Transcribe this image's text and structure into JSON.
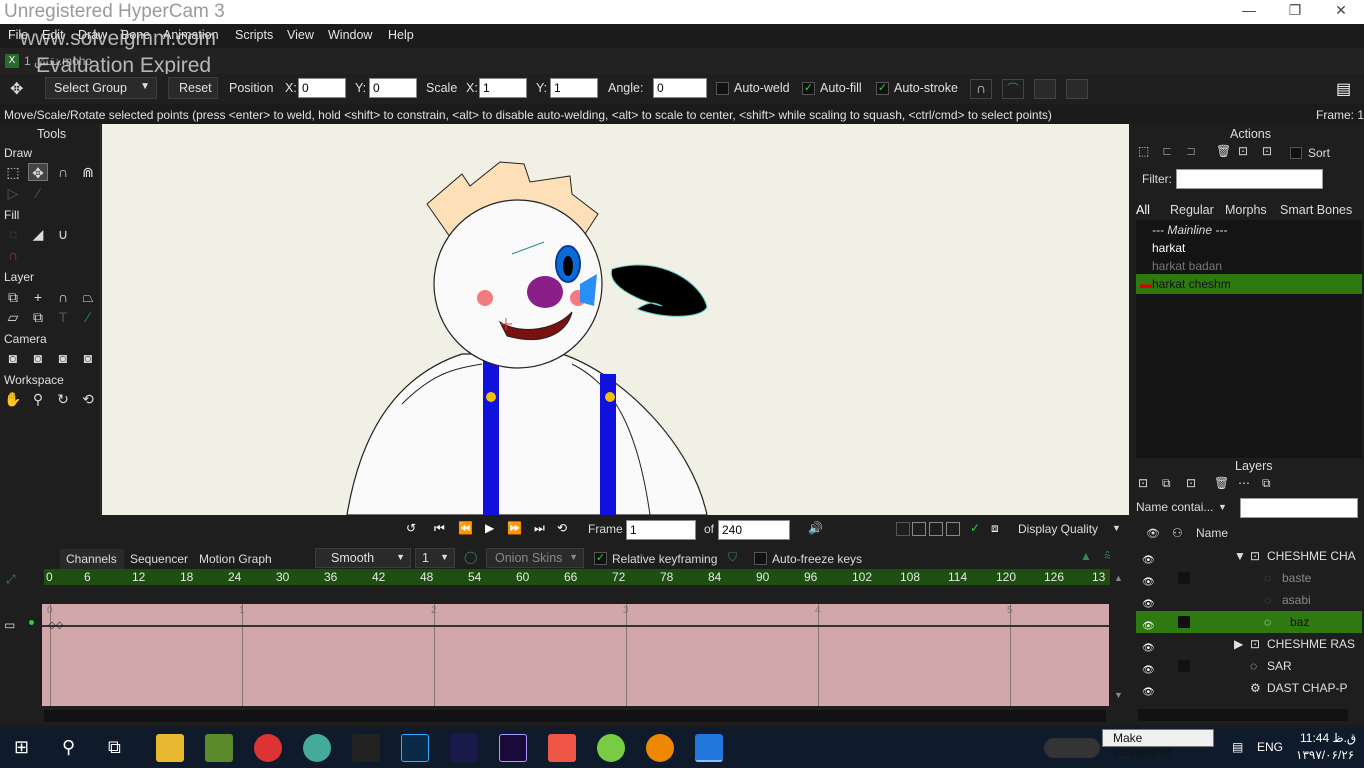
{
  "titlebar": {
    "title": "Unregistered HyperCam 3",
    "minimize": "—",
    "restore": "❐",
    "close": "✕"
  },
  "watermark": {
    "line1": "www.solveigmm.com",
    "line2": "Evaluation Expired"
  },
  "menu": [
    "File",
    "Edit",
    "Draw",
    "Bone",
    "Animation",
    "Scripts",
    "View",
    "Window",
    "Help"
  ],
  "doc_tab": {
    "label": "نقش 1.moho",
    "close": "X"
  },
  "toolopts": {
    "select_group": "Select Group",
    "reset": "Reset",
    "position": "Position",
    "x_lbl": "X:",
    "x_val": "0",
    "y_lbl": "Y:",
    "y_val": "0",
    "scale": "Scale",
    "sx_lbl": "X:",
    "sx_val": "1",
    "sy_lbl": "Y:",
    "sy_val": "1",
    "angle_lbl": "Angle:",
    "angle_val": "0",
    "autoweld": "Auto-weld",
    "autofill": "Auto-fill",
    "autostroke": "Auto-stroke"
  },
  "status": {
    "text": "Move/Scale/Rotate selected points (press <enter> to weld, hold <shift> to constrain, <alt> to disable auto-welding, <alt> to scale to center, <shift> while scaling to squash, <ctrl/cmd> to select points)",
    "frame": "Frame: 1"
  },
  "tools": {
    "title": "Tools",
    "draw": "Draw",
    "fill": "Fill",
    "layer": "Layer",
    "camera": "Camera",
    "workspace": "Workspace"
  },
  "actions": {
    "title": "Actions",
    "sort": "Sort",
    "filter": "Filter:",
    "tabs": [
      "All",
      "Regular",
      "Morphs",
      "Smart Bones"
    ],
    "items": [
      "--- Mainline ---",
      "harkat",
      "harkat badan",
      "harkat cheshm"
    ]
  },
  "layers_panel": {
    "title": "Layers",
    "name_filter": "Name contai...",
    "col_name": "Name",
    "rows": [
      "CHESHME CHA",
      "baste",
      "asabi",
      "baz",
      "CHESHME RAS",
      "SAR",
      "DAST CHAP-P"
    ]
  },
  "playbar": {
    "frame_lbl": "Frame",
    "frame_val": "1",
    "of_lbl": "of",
    "of_val": "240",
    "quality": "Display Quality"
  },
  "timeline": {
    "tabs": [
      "Channels",
      "Sequencer",
      "Motion Graph"
    ],
    "interp": "Smooth",
    "interp_n": "1",
    "onion": "Onion Skins",
    "relative": "Relative keyframing",
    "autofreeze": "Auto-freeze keys",
    "ruler": [
      "0",
      "6",
      "12",
      "18",
      "24",
      "30",
      "36",
      "42",
      "48",
      "54",
      "60",
      "66",
      "72",
      "78",
      "84",
      "90",
      "96",
      "102",
      "108",
      "114",
      "120",
      "126",
      "13"
    ],
    "seconds": [
      "0",
      "1",
      "2",
      "3",
      "4",
      "5"
    ]
  },
  "taskbar": {
    "tooltip": "Make screenshot",
    "lang": "ENG",
    "time": "11:44 ق.ظ",
    "date": "۱۳۹۷/۰۶/۲۶"
  }
}
